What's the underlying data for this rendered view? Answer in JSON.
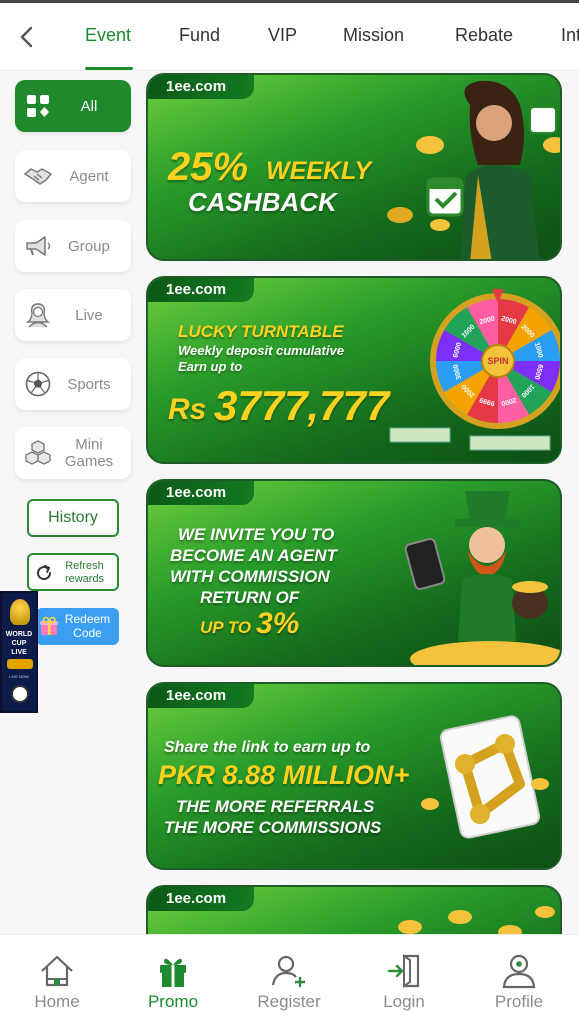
{
  "tabs": [
    "Event",
    "Fund",
    "VIP",
    "Mission",
    "Rebate",
    "Int"
  ],
  "categories": [
    "All",
    "Agent",
    "Group",
    "Live",
    "Sports",
    "Mini Games"
  ],
  "side_buttons": {
    "history": "History",
    "refresh": "Refresh rewards",
    "redeem": "Redeem Code"
  },
  "worldcup": {
    "line1": "WORLD",
    "line2": "CUP",
    "line3": "LIVE",
    "sub": "LIVE NOW"
  },
  "banners": [
    {
      "brand": "1ee.com",
      "lines": [
        "25%",
        "WEEKLY",
        "CASHBACK"
      ]
    },
    {
      "brand": "1ee.com",
      "lines": [
        "LUCKY TURNTABLE",
        "Weekly deposit cumulative",
        "Earn up to",
        "Rs",
        "3777,777"
      ],
      "wheel": [
        "2000",
        "2000",
        "1000",
        "6500",
        "1000",
        "2000",
        "9999",
        "2000",
        "3000",
        "6000",
        "1000",
        "2000"
      ],
      "spin": "SPIN"
    },
    {
      "brand": "1ee.com",
      "lines": [
        "WE INVITE YOU TO",
        "BECOME AN AGENT",
        "WITH COMMISSION",
        "RETURN OF",
        "UP TO",
        "3%"
      ]
    },
    {
      "brand": "1ee.com",
      "lines": [
        "Share the link to earn up to",
        "PKR 8.88 MILLION+",
        "THE MORE REFERRALS",
        "THE MORE COMMISSIONS"
      ]
    },
    {
      "brand": "1ee.com",
      "lines": []
    }
  ],
  "nav": [
    "Home",
    "Promo",
    "Register",
    "Login",
    "Profile"
  ],
  "colors": {
    "accent": "#1e8a2e",
    "redeem": "#3a9ff2",
    "banner": "#2a9d2a",
    "gold": "#ffd21f"
  }
}
